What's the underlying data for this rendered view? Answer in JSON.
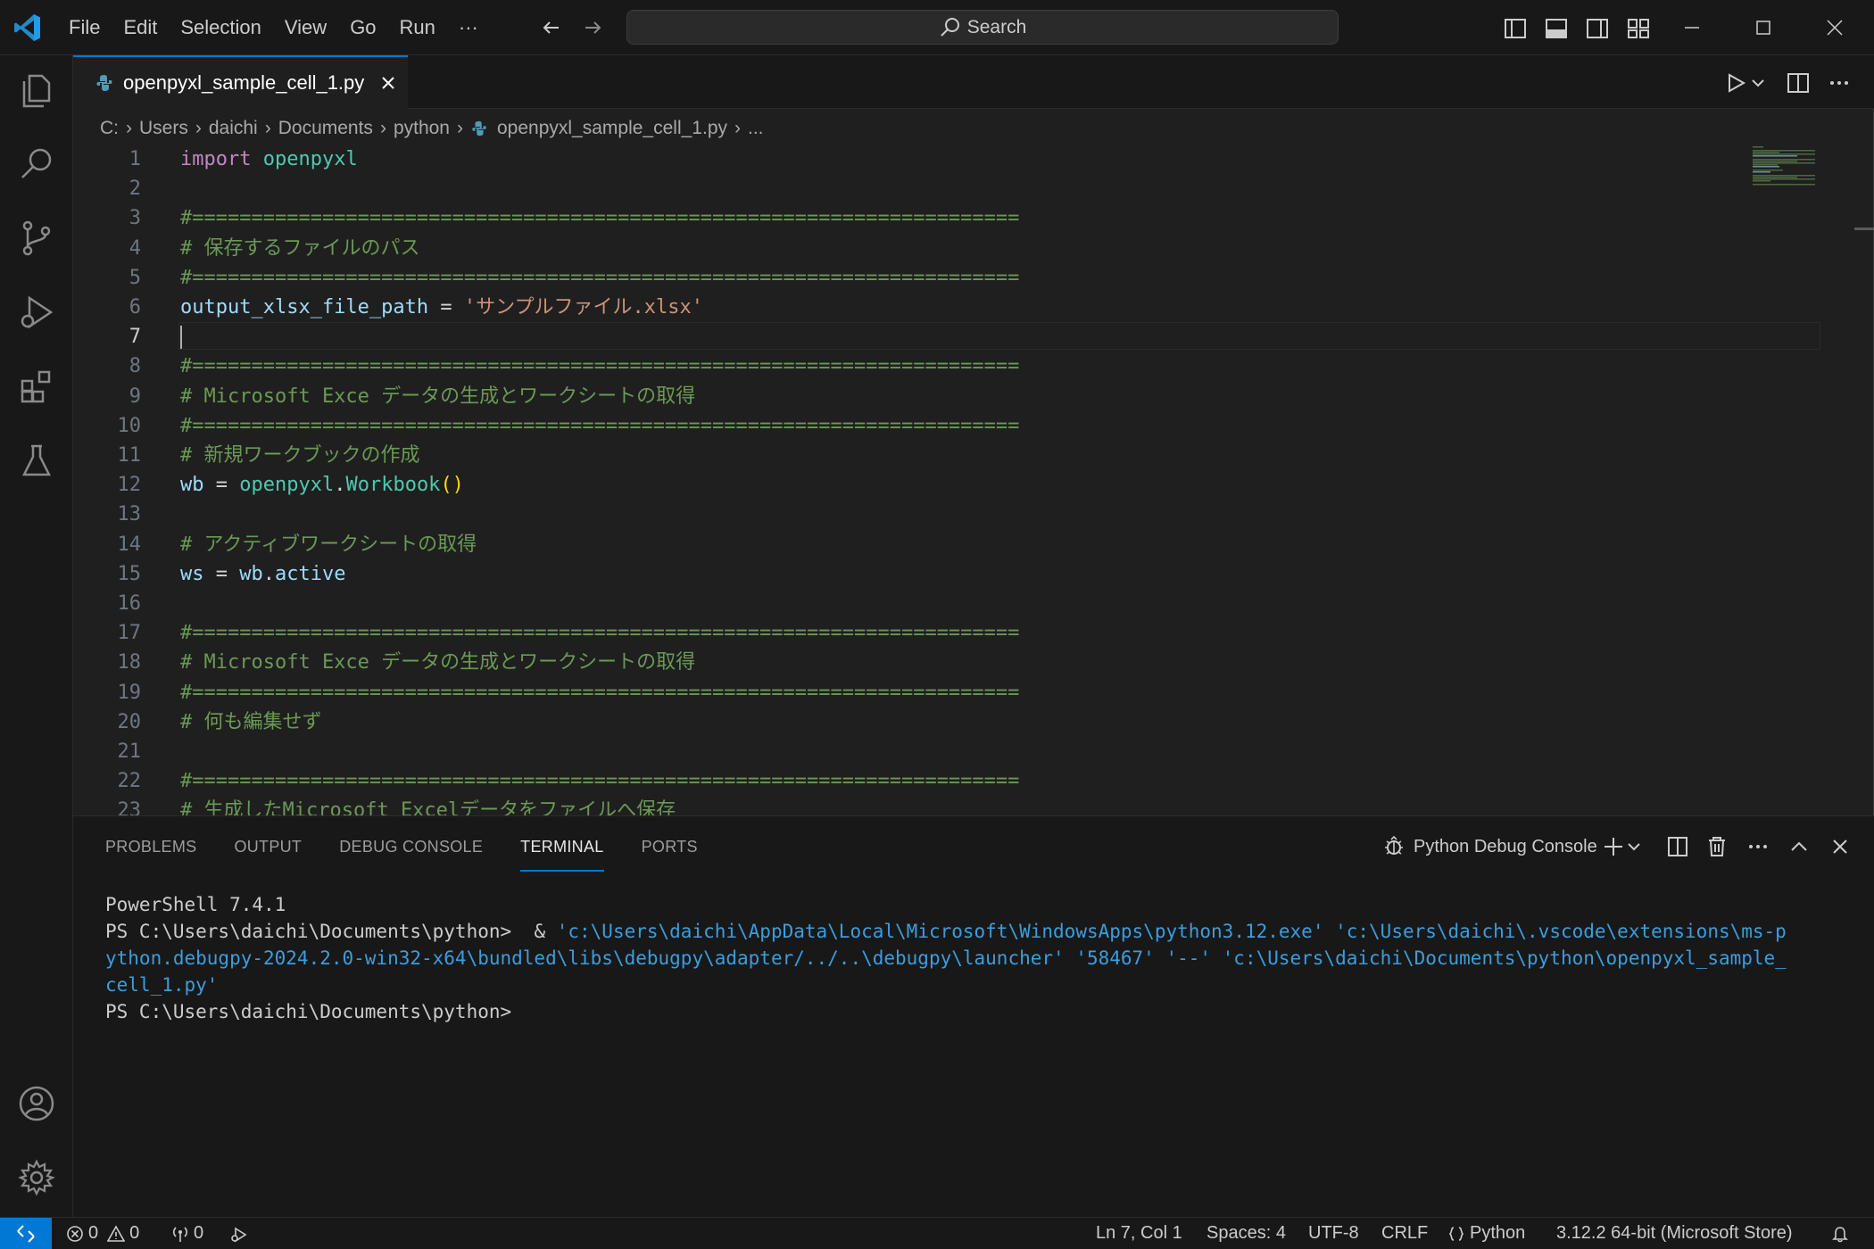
{
  "menu": [
    "File",
    "Edit",
    "Selection",
    "View",
    "Go",
    "Run",
    "···"
  ],
  "search": {
    "label": "Search"
  },
  "tab": {
    "filename": "openpyxl_sample_cell_1.py"
  },
  "breadcrumb": [
    "C:",
    "Users",
    "daichi",
    "Documents",
    "python",
    "openpyxl_sample_cell_1.py",
    "..."
  ],
  "code": {
    "lines": [
      {
        "n": "1",
        "parts": [
          [
            "k",
            "import"
          ],
          [
            "o",
            " "
          ],
          [
            "m",
            "openpyxl"
          ]
        ]
      },
      {
        "n": "2",
        "parts": []
      },
      {
        "n": "3",
        "parts": [
          [
            "c",
            "#======================================================================"
          ]
        ]
      },
      {
        "n": "4",
        "parts": [
          [
            "c",
            "# 保存するファイルのパス"
          ]
        ]
      },
      {
        "n": "5",
        "parts": [
          [
            "c",
            "#======================================================================"
          ]
        ]
      },
      {
        "n": "6",
        "parts": [
          [
            "v",
            "output_xlsx_file_path"
          ],
          [
            "o",
            " = "
          ],
          [
            "s",
            "'サンプルファイル.xlsx'"
          ]
        ]
      },
      {
        "n": "7",
        "parts": [],
        "current": true
      },
      {
        "n": "8",
        "parts": [
          [
            "c",
            "#======================================================================"
          ]
        ]
      },
      {
        "n": "9",
        "parts": [
          [
            "c",
            "# Microsoft Exce データの生成とワークシートの取得"
          ]
        ]
      },
      {
        "n": "10",
        "parts": [
          [
            "c",
            "#======================================================================"
          ]
        ]
      },
      {
        "n": "11",
        "parts": [
          [
            "c",
            "# 新規ワークブックの作成"
          ]
        ]
      },
      {
        "n": "12",
        "parts": [
          [
            "v",
            "wb"
          ],
          [
            "o",
            " = "
          ],
          [
            "m",
            "openpyxl"
          ],
          [
            "o",
            "."
          ],
          [
            "m",
            "Workbook"
          ],
          [
            "p",
            "()"
          ]
        ]
      },
      {
        "n": "13",
        "parts": []
      },
      {
        "n": "14",
        "parts": [
          [
            "c",
            "# アクティブワークシートの取得"
          ]
        ]
      },
      {
        "n": "15",
        "parts": [
          [
            "v",
            "ws"
          ],
          [
            "o",
            " = "
          ],
          [
            "v",
            "wb"
          ],
          [
            "o",
            "."
          ],
          [
            "v",
            "active"
          ]
        ]
      },
      {
        "n": "16",
        "parts": []
      },
      {
        "n": "17",
        "parts": [
          [
            "c",
            "#======================================================================"
          ]
        ]
      },
      {
        "n": "18",
        "parts": [
          [
            "c",
            "# Microsoft Exce データの生成とワークシートの取得"
          ]
        ]
      },
      {
        "n": "19",
        "parts": [
          [
            "c",
            "#======================================================================"
          ]
        ]
      },
      {
        "n": "20",
        "parts": [
          [
            "c",
            "# 何も編集せず"
          ]
        ]
      },
      {
        "n": "21",
        "parts": []
      },
      {
        "n": "22",
        "parts": [
          [
            "c",
            "#======================================================================"
          ]
        ]
      },
      {
        "n": "23",
        "parts": [
          [
            "c",
            "# 生成したMicrosoft Excelデータをファイルへ保存"
          ]
        ]
      }
    ]
  },
  "panel": {
    "tabs": [
      "PROBLEMS",
      "OUTPUT",
      "DEBUG CONSOLE",
      "TERMINAL",
      "PORTS"
    ],
    "active_tab": "TERMINAL",
    "terminal_name": "Python Debug Console"
  },
  "terminal": {
    "line1": "PowerShell 7.4.1",
    "prompt": "PS C:\\Users\\daichi\\Documents\\python> ",
    "cmd_amp": " & ",
    "cmd_1": "'c:\\Users\\daichi\\AppData\\Local\\Microsoft\\WindowsApps\\python3.12.exe' 'c:\\Users\\daichi\\.vscode\\extensions\\ms-p",
    "cmd_2": "ython.debugpy-2024.2.0-win32-x64\\bundled\\libs\\debugpy\\adapter/../..\\debugpy\\launcher' '58467' '--' 'c:\\Users\\daichi\\Documents\\python\\openpyxl_sample_",
    "cmd_3": "cell_1.py'",
    "line_last": "PS C:\\Users\\daichi\\Documents\\python>"
  },
  "status": {
    "errors": "0",
    "warnings": "0",
    "ports": "0",
    "position": "Ln 7, Col 1",
    "spaces": "Spaces: 4",
    "encoding": "UTF-8",
    "eol": "CRLF",
    "language": "Python",
    "interpreter": "3.12.2 64-bit (Microsoft Store)"
  },
  "colors": {
    "accent": "#0078d4",
    "comment": "#6a9955",
    "string": "#ce9178",
    "keyword": "#c586c0",
    "type": "#4ec9b0",
    "variable": "#9cdcfe"
  }
}
